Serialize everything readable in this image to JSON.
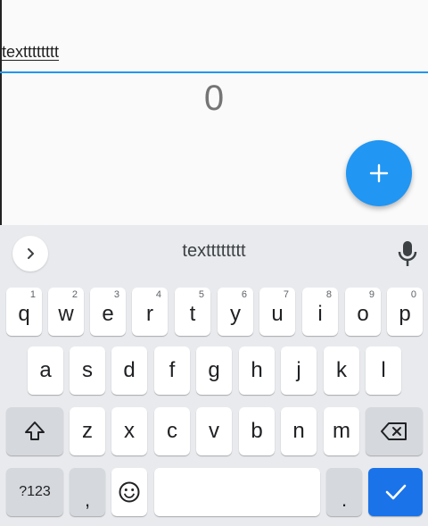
{
  "app": {
    "input_value": "textttttttt",
    "counter": "0",
    "fab_color": "#2196f3",
    "fab_icon": "plus-icon"
  },
  "keyboard": {
    "suggestion": "textttttttt",
    "expand_icon": "chevron-right-icon",
    "mic_icon": "mic-icon",
    "row1": [
      {
        "label": "q",
        "hint": "1"
      },
      {
        "label": "w",
        "hint": "2"
      },
      {
        "label": "e",
        "hint": "3"
      },
      {
        "label": "r",
        "hint": "4"
      },
      {
        "label": "t",
        "hint": "5"
      },
      {
        "label": "y",
        "hint": "6"
      },
      {
        "label": "u",
        "hint": "7"
      },
      {
        "label": "i",
        "hint": "8"
      },
      {
        "label": "o",
        "hint": "9"
      },
      {
        "label": "p",
        "hint": "0"
      }
    ],
    "row2": [
      "a",
      "s",
      "d",
      "f",
      "g",
      "h",
      "j",
      "k",
      "l"
    ],
    "row3": [
      "z",
      "x",
      "c",
      "v",
      "b",
      "n",
      "m"
    ],
    "symbols_label": "?123",
    "comma_label": ",",
    "period_label": ".",
    "shift_icon": "shift-icon",
    "backspace_icon": "backspace-icon",
    "emoji_icon": "emoji-icon",
    "enter_icon": "checkmark-icon",
    "accent_color": "#1a73e8"
  }
}
